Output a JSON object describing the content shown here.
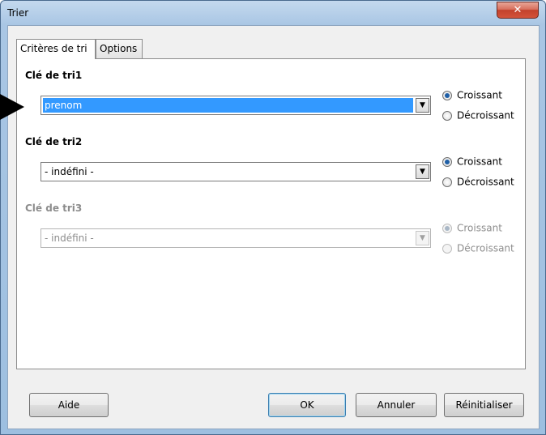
{
  "window": {
    "title": "Trier",
    "close_glyph": "✕"
  },
  "tabs": [
    {
      "label": "Critères de tri",
      "active": true
    },
    {
      "label": "Options",
      "active": false
    }
  ],
  "sort_keys": [
    {
      "title": "Clé de tri1",
      "value": "prenom",
      "enabled": true,
      "highlighted": true,
      "ascending_label": "Croissant",
      "descending_label": "Décroissant",
      "ascending_checked": true
    },
    {
      "title": "Clé de tri2",
      "value": "- indéfini -",
      "enabled": true,
      "highlighted": false,
      "ascending_label": "Croissant",
      "descending_label": "Décroissant",
      "ascending_checked": true
    },
    {
      "title": "Clé de tri3",
      "value": "- indéfini -",
      "enabled": false,
      "highlighted": false,
      "ascending_label": "Croissant",
      "descending_label": "Décroissant",
      "ascending_checked": true
    }
  ],
  "buttons": {
    "help": "Aide",
    "ok": "OK",
    "cancel": "Annuler",
    "reset": "Réinitialiser"
  },
  "icons": {
    "dropdown": "chevron-down-icon",
    "pointer": "arrow-right-icon"
  }
}
